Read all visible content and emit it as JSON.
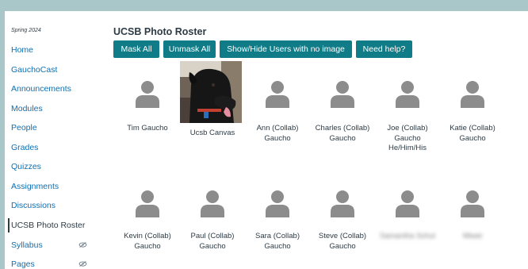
{
  "sidebar": {
    "term": "Spring 2024",
    "items": [
      {
        "label": "Home"
      },
      {
        "label": "GauchoCast"
      },
      {
        "label": "Announcements"
      },
      {
        "label": "Modules"
      },
      {
        "label": "People"
      },
      {
        "label": "Grades"
      },
      {
        "label": "Quizzes"
      },
      {
        "label": "Assignments"
      },
      {
        "label": "Discussions"
      },
      {
        "label": "UCSB Photo Roster",
        "active": true
      },
      {
        "label": "Syllabus",
        "hidden_icon": "eye-slash-icon"
      },
      {
        "label": "Pages",
        "hidden_icon": "eye-slash-icon"
      }
    ]
  },
  "main": {
    "title": "UCSB Photo Roster",
    "buttons": [
      {
        "label": "Mask All"
      },
      {
        "label": "Unmask All"
      },
      {
        "label": "Show/Hide Users with no image"
      },
      {
        "label": "Need help?"
      }
    ],
    "roster_row1": [
      {
        "name": "Tim Gaucho"
      },
      {
        "name": "Ucsb Canvas"
      },
      {
        "name": "Ann (Collab) Gaucho"
      },
      {
        "name": "Charles (Collab) Gaucho"
      },
      {
        "name": "Joe (Collab) Gaucho He/Him/His"
      },
      {
        "name": "Katie (Collab) Gaucho"
      }
    ],
    "roster_row2": [
      {
        "name": "Kevin (Collab) Gaucho"
      },
      {
        "name": "Paul (Collab) Gaucho"
      },
      {
        "name": "Sara (Collab) Gaucho"
      },
      {
        "name": "Steve (Collab) Gaucho"
      },
      {
        "name": "Samantha Schul",
        "blurred": true
      },
      {
        "name": "Miwei",
        "blurred": true
      }
    ]
  },
  "colors": {
    "accent": "#0f7c87",
    "link": "#0e6fb2",
    "text": "#2d3b45",
    "placeholder": "#8c8c8c"
  }
}
